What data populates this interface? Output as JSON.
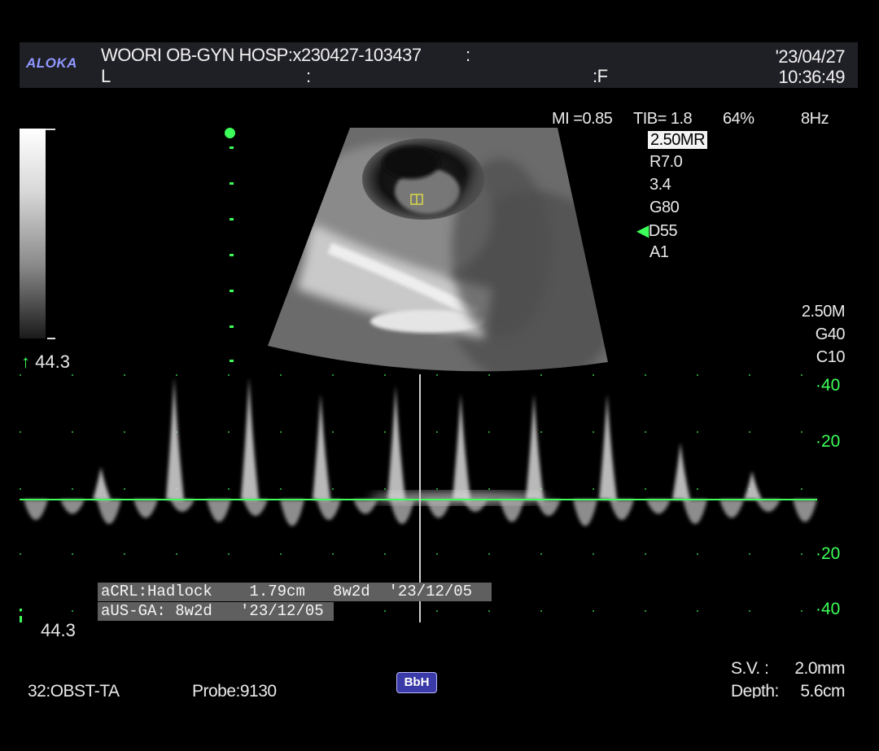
{
  "header": {
    "logo": "ALOKA",
    "hospital_id": "WOORI OB-GYN HOSP:x230427-103437",
    "colon1": ":",
    "line2_L": "L",
    "line2_colon": ":",
    "line2_F": ":F",
    "date": "'23/04/27",
    "time": "10:36:49"
  },
  "params": {
    "mi": "MI =0.85",
    "tib": "TIB= 1.8",
    "power": "64%",
    "rate": "8Hz",
    "freq_selected": "2.50MR",
    "list": [
      "R7.0",
      "3.4",
      "G80",
      "D55",
      "A1"
    ],
    "doppler_list": [
      "2.50M",
      "G40",
      "C10"
    ]
  },
  "velocity": {
    "top_value": "44.3",
    "bottom_value": "44.3",
    "scale_labels": [
      "40",
      "20",
      "20",
      "40"
    ]
  },
  "measurements": {
    "line1": "aCRL:Hadlock    1.79cm   8w2d  '23/12/05",
    "line2": "aUS-GA: 8w2d   '23/12/05"
  },
  "footer": {
    "preset": "32:OBST-TA",
    "probe": "Probe:9130",
    "badge": "BbH",
    "sv_label": "S.V. :",
    "sv_value": "2.0mm",
    "depth_label": "Depth:",
    "depth_value": "5.6cm"
  },
  "colors": {
    "accent_green": "#3dff5a",
    "logo_blue": "#8f98ff",
    "header_bg": "#1f1f26",
    "badge_blue": "#3a3aa8"
  }
}
